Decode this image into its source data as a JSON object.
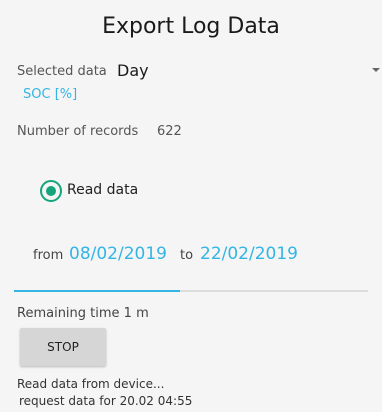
{
  "header": {
    "title": "Export Log Data"
  },
  "selection": {
    "label": "Selected data",
    "value": "Day",
    "secondary": "SOC [%]"
  },
  "records": {
    "label": "Number of records",
    "count": "622"
  },
  "mode": {
    "label": "Read data",
    "selected": true
  },
  "range": {
    "from_label": "from",
    "from_date": "08/02/2019",
    "to_label": "to",
    "to_date": "22/02/2019"
  },
  "progress": {
    "fraction": 0.47
  },
  "status": {
    "remaining": "Remaining time 1 m"
  },
  "actions": {
    "stop_label": "STOP"
  },
  "log": {
    "line1": "Read data from device...",
    "line2": "request data for 20.02 04:55"
  },
  "colors": {
    "accent": "#33b5e5",
    "radio": "#14a57c",
    "button": "#d6d6d6",
    "background": "#f5f5f5"
  }
}
